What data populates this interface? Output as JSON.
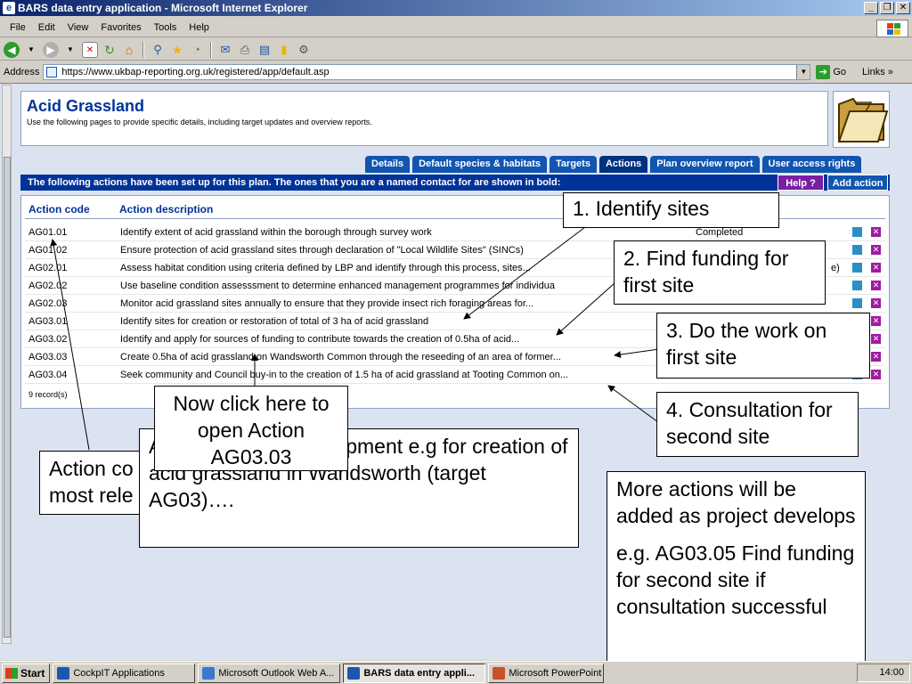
{
  "window": {
    "title": "BARS data entry application - Microsoft Internet Explorer",
    "buttons": [
      "_",
      "❐",
      "✕"
    ]
  },
  "menu": [
    "File",
    "Edit",
    "View",
    "Favorites",
    "Tools",
    "Help"
  ],
  "address": {
    "label": "Address",
    "url": "https://www.ukbap-reporting.org.uk/registered/app/default.asp",
    "go": "Go",
    "links": "Links"
  },
  "header": {
    "title": "Acid Grassland",
    "subtitle": "Use the following pages to provide specific details, including target updates and overview reports."
  },
  "tabs": [
    "Details",
    "Default species & habitats",
    "Targets",
    "Actions",
    "Plan overview report",
    "User access rights"
  ],
  "bar": {
    "text": "The following actions have been set up for this plan. The ones that you are a named contact for are shown in bold:",
    "help": "Help ?",
    "add": "Add action"
  },
  "table": {
    "col_code": "Action code",
    "col_desc": "Action description",
    "rows": [
      {
        "code": "AG01.01",
        "desc": "Identify extent of acid grassland within the borough through survey work",
        "status": "Completed"
      },
      {
        "code": "AG01.02",
        "desc": "Ensure protection of acid grassland sites through declaration of \"Local Wildlife Sites\" (SINCs)",
        "status": ""
      },
      {
        "code": "AG02.01",
        "desc": "Assess habitat condition using criteria defined by LBP and identify through this process, sites...",
        "status": "e)"
      },
      {
        "code": "AG02.02",
        "desc": "Use baseline condition assesssment to determine enhanced management programmes for individua",
        "status": ""
      },
      {
        "code": "AG02.03",
        "desc": "Monitor acid grassland sites annually to ensure that they provide insect rich foraging areas for...",
        "status": ""
      },
      {
        "code": "AG03.01",
        "desc": "Identify sites for creation or restoration of total of 3 ha of acid grassland",
        "status": ""
      },
      {
        "code": "AG03.02",
        "desc": "Identify and apply for sources of funding to contribute towards the creation of 0.5ha of acid...",
        "status": ""
      },
      {
        "code": "AG03.03",
        "desc": "Create 0.5ha of acid grassland on Wandsworth Common through the reseeding of an area of former...",
        "status": ""
      },
      {
        "code": "AG03.04",
        "desc": "Seek community and Council buy-in to the creation of 1.5 ha of acid grassland at Tooting Common on...",
        "status": ""
      }
    ],
    "records": "9 record(s)"
  },
  "callouts": {
    "identify": "1. Identify sites",
    "funding": "2. Find funding for first site",
    "work": "3. Do the work on first site",
    "consultation": "4. Consultation for second site",
    "click_here": "Now click here to open Action AG03.03",
    "action_code": "Action co most rele",
    "stage": "A ge of project development e.g for creation of acid grassland in Wandsworth (target AG03)….",
    "more_actions": "More actions will be added as project develops",
    "example": "e.g. AG03.05 Find funding for second site if consultation successful"
  },
  "taskbar": {
    "start": "Start",
    "tasks": [
      "CockpIT Applications",
      "Microsoft Outlook Web A...",
      "BARS data entry appli...",
      "Microsoft PowerPoint -"
    ],
    "clock": "14:00"
  },
  "colors": {
    "titlebar": "#0a246a",
    "tab": "#1155b0",
    "bar": "#003399",
    "help": "#7b1fa2"
  }
}
